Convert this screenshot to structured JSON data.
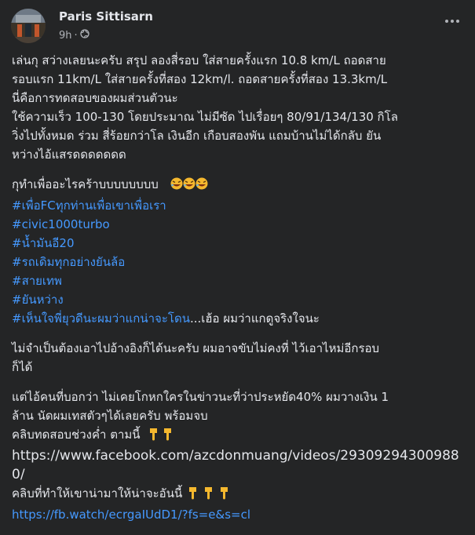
{
  "post": {
    "author": "Paris Sittisarn",
    "time": "9h",
    "dot": "·",
    "audience_icon": "globe-icon",
    "more_icon": "more-options-icon"
  },
  "content": {
    "p1": [
      "เล่นกุ สว่างเลยนะครับ  สรุป ลองสี่รอบ  ใส่สายครั้งแรก  10.8 km/L ถอดสาย",
      "รอบแรก 11km/L ใส่สายครั้งที่สอง 12km/l. ถอดสายครั้งที่สอง 13.3km/L",
      "นี่คือการทดสอบของผมส่วนตัวนะ",
      "ใช้ความเร็ว 100-130 โดยประมาณ  ไม่มีซัด ไปเรื่อยๆ  80/91/134/130 กิโล",
      "วิ่งไปทั้งหมด  ร่วม สี่ร้อยกว่าโล  เงินอีก เกือบสองพัน   แถมบ้านไม่ได้กลับ  ยัน",
      "หว่างไอ้แสรดดดดดดด"
    ],
    "p2_line1": "กุทำเพื่ออะไรคร้าบบบบบบบบ",
    "hashtags": [
      "#เพื่อFCทุกท่านเพื่อเขาเพื่อเรา",
      "#civic1000turbo",
      "#น้ำมันอี20",
      "#รถเดิมทุกอย่างยันล้อ",
      "#สายเทพ",
      "#ยันหว่าง",
      "#เห็นใจพี่ยุวดีนะผมว่าแกน่าจะโดน"
    ],
    "p2_tail": "...เฮ้อ  ผมว่าแกดูจริงใจนะ",
    "p3": [
      "ไม่จำเป็นต้องเอาไปอ้างอิงก็ได้นะครับ ผมอาจขับไม่คงที่   ไว้เอาไหม่อีกรอบ",
      "ก็ได้"
    ],
    "p4_lines": [
      "แต่ไอ้คนที่บอกว่า  ไม่เคยโกหกใครในข่าวนะที่ว่าประหยัด40% ผมวางเงิน 1",
      "ล้าน นัดผมเทสตัวๆได้เลยครับ  พร้อมจบ"
    ],
    "p4_clip1": "คลิบทดสอบช่วงค่ำ ตามนี้",
    "p4_url1": [
      "https://www.facebook.com/azcdonmuang/videos/29309294300988",
      "0/"
    ],
    "p4_clip2": "คลิบที่ทำให้เขาน่ามาให้น่าจะอันนี้",
    "p4_url2": "https://fb.watch/ecrgaIUdD1/?fs=e&s=cl"
  }
}
